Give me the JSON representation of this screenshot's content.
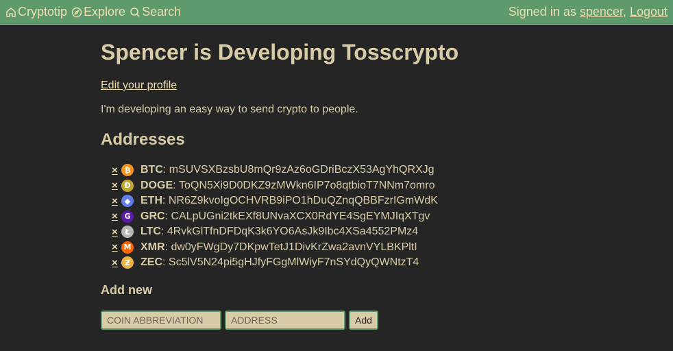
{
  "nav": {
    "brand": "Cryptotip",
    "explore": "Explore",
    "search": "Search",
    "signed_in_prefix": "Signed in as",
    "username": "spencer",
    "separator": ",",
    "logout": "Logout"
  },
  "profile": {
    "title": "Spencer is Developing Tosscrypto",
    "edit_link": "Edit your profile",
    "bio": "I'm developing an easy way to send crypto to people."
  },
  "addresses": {
    "heading": "Addresses",
    "remove_label": "×",
    "items": [
      {
        "ticker": "BTC",
        "address": "mSUVSXBzsbU8mQr9zAz6oGDriBczX53AgYhQRXJg",
        "color": "#f7931a",
        "glyph": "₿"
      },
      {
        "ticker": "DOGE",
        "address": "ToQN5Xi9D0DKZ9zMWkn6IP7o8qtbioT7NNm7omro",
        "color": "#c2a633",
        "glyph": "Ð"
      },
      {
        "ticker": "ETH",
        "address": "NR6Z9kvoIgOCHVRB9iPO1hDuQZnqQBBFzrIGmWdK",
        "color": "#627eea",
        "glyph": "◆"
      },
      {
        "ticker": "GRC",
        "address": "CALpUGni2tkEXf8UNvaXCX0RdYE4SgEYMJIqXTgv",
        "color": "#5a1aa8",
        "glyph": "G"
      },
      {
        "ticker": "LTC",
        "address": "4RvkGlTfnDFDqK3k6YO6AsJk9Ibc4XSa4552PMz4",
        "color": "#b8b8b8",
        "glyph": "Ł"
      },
      {
        "ticker": "XMR",
        "address": "dw0yFWgDy7DKpwTetJ1DivKrZwa2avnVYLBKPltI",
        "color": "#ff6600",
        "glyph": "M"
      },
      {
        "ticker": "ZEC",
        "address": "Sc5lV5N24pi5gHJfyFGgMlWiyF7nSYdQyQWNtzT4",
        "color": "#ecb244",
        "glyph": "Ƶ"
      }
    ]
  },
  "add_new": {
    "heading": "Add new",
    "coin_placeholder": "COIN ABBREVIATION",
    "address_placeholder": "ADDRESS",
    "add_button": "Add"
  },
  "colors": {
    "topbar": "#5e9a6b",
    "background": "#252526",
    "text": "#d8cca8"
  }
}
